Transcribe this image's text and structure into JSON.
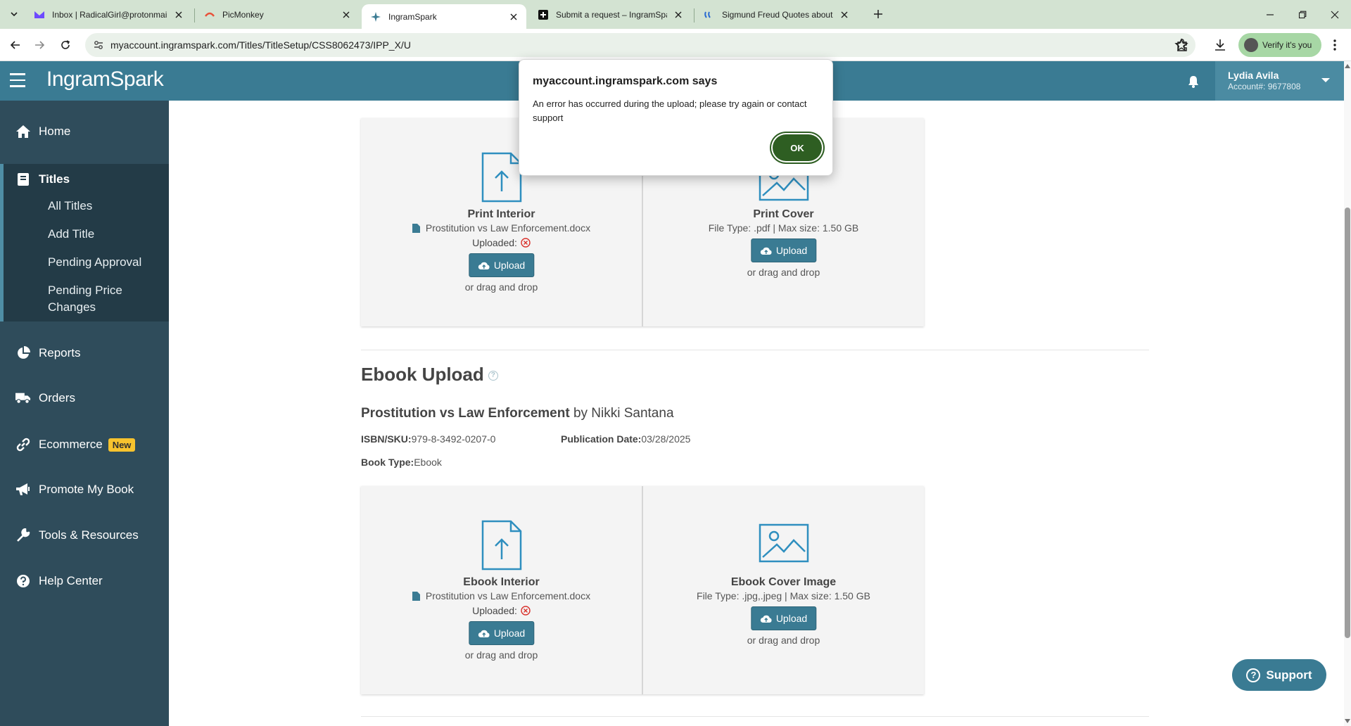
{
  "browser": {
    "tabs": [
      {
        "title": "Inbox | RadicalGirl@protonmail",
        "favicon": "proton-mail-icon",
        "active": false
      },
      {
        "title": "PicMonkey",
        "favicon": "picmonkey-icon",
        "active": false
      },
      {
        "title": "IngramSpark",
        "favicon": "ingramspark-icon",
        "active": true
      },
      {
        "title": "Submit a request – IngramSpark",
        "favicon": "zendesk-icon",
        "active": false
      },
      {
        "title": "Sigmund Freud Quotes about S",
        "favicon": "quotes-icon",
        "active": false
      }
    ],
    "url": "myaccount.ingramspark.com/Titles/TitleSetup/CSS8062473/IPP_X/U",
    "verify_label": "Verify it's you"
  },
  "header": {
    "logo": "IngramSpark",
    "user_name": "Lydia Avila",
    "account": "Account#: 9677808"
  },
  "sidebar": {
    "home": "Home",
    "titles": "Titles",
    "titles_sub": [
      "All Titles",
      "Add Title",
      "Pending Approval",
      "Pending Price",
      "Changes"
    ],
    "reports": "Reports",
    "orders": "Orders",
    "ecommerce": "Ecommerce",
    "ecommerce_badge": "New",
    "promote": "Promote My Book",
    "tools": "Tools & Resources",
    "help": "Help Center"
  },
  "print_upload": {
    "interior_title": "Print Interior",
    "interior_file": "Prostitution vs Law Enforcement.docx",
    "interior_status": "Uploaded:",
    "cover_title": "Print Cover",
    "cover_filetype": "File Type: .pdf | Max size: 1.50 GB",
    "upload_label": "Upload",
    "drag_label": "or drag and drop"
  },
  "ebook": {
    "section_title": "Ebook Upload",
    "book_title": "Prostitution vs Law Enforcement",
    "by_author": "by Nikki Santana",
    "isbn_label": "ISBN/SKU:",
    "isbn": "979-8-3492-0207-0",
    "pubdate_label": "Publication Date:",
    "pubdate": "03/28/2025",
    "booktype_label": "Book Type:",
    "booktype": "Ebook",
    "interior_title": "Ebook Interior",
    "interior_file": "Prostitution vs Law Enforcement.docx",
    "interior_status": "Uploaded:",
    "cover_title": "Ebook Cover Image",
    "cover_filetype": "File Type: .jpg,.jpeg | Max size: 1.50 GB",
    "upload_label": "Upload",
    "drag_label": "or drag and drop"
  },
  "support_label": "Support",
  "dialog": {
    "title": "myaccount.ingramspark.com says",
    "message": "An error has occurred during the upload; please try again or contact support",
    "ok_label": "OK"
  },
  "colors": {
    "header": "#3a7b93",
    "sidebar": "#2f4c5b",
    "accent": "#3a7b93",
    "ok_button": "#2e5e22"
  }
}
